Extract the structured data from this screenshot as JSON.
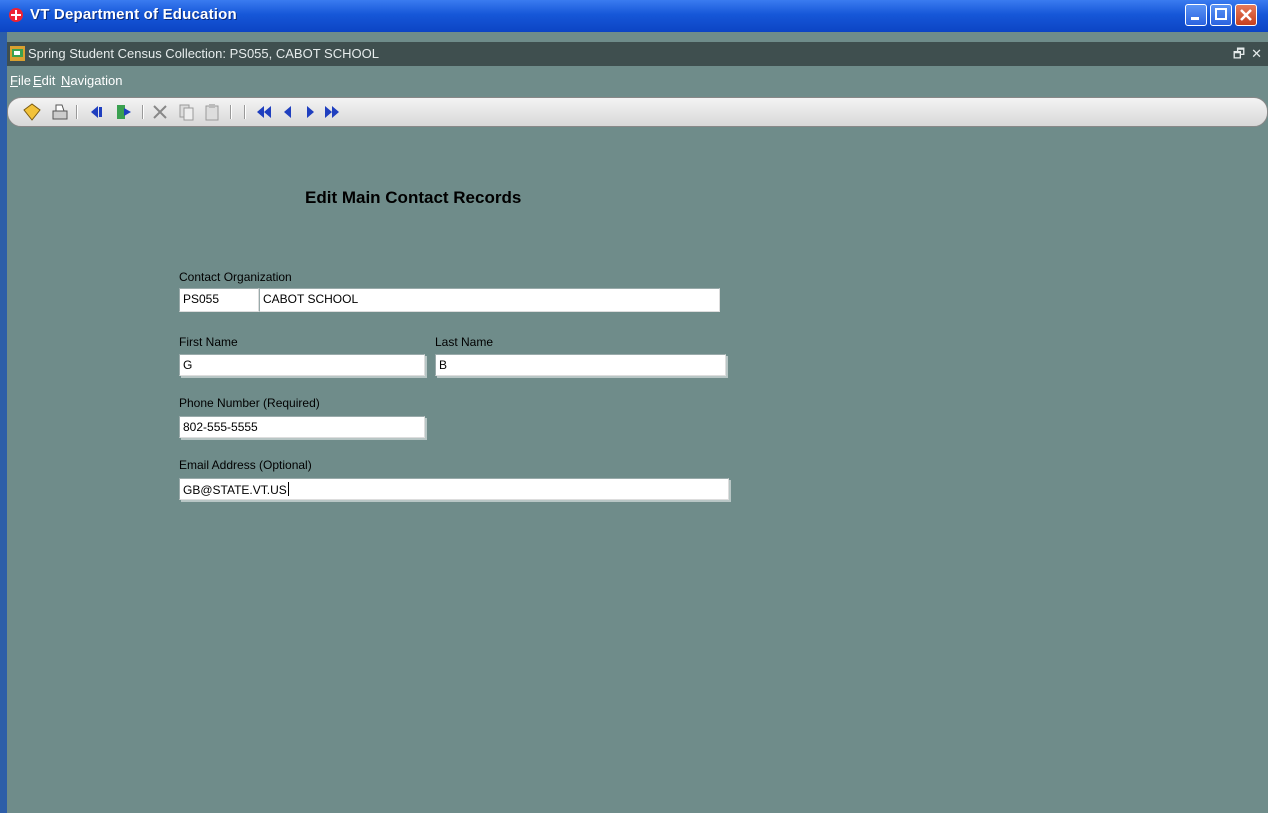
{
  "window": {
    "title": "VT Department of Education"
  },
  "form_window": {
    "title": "Spring Student Census Collection: PS055, CABOT SCHOOL"
  },
  "menu": {
    "file": "File",
    "edit": "Edit",
    "navigation": "Navigation"
  },
  "toolbar": {
    "icons": [
      "save-icon",
      "print-icon",
      "previous-record-icon",
      "exit-icon",
      "cut-icon",
      "copy-icon",
      "paste-icon",
      "first-record-icon",
      "prev-icon",
      "next-icon",
      "last-record-icon"
    ]
  },
  "page": {
    "heading": "Edit  Main Contact Records"
  },
  "form": {
    "contact_org_label": "Contact Organization",
    "org_code": "PS055",
    "org_name": "CABOT SCHOOL",
    "first_name_label": "First Name",
    "first_name": "G",
    "last_name_label": "Last Name",
    "last_name": "B",
    "phone_label": "Phone Number (Required)",
    "phone": "802-555-5555",
    "email_label": "Email Address (Optional)",
    "email": "GB@STATE.VT.US"
  },
  "colors": {
    "background": "#6f8c8a",
    "title_bar": "#1657d8",
    "inner_bar": "#3f4f4f"
  }
}
